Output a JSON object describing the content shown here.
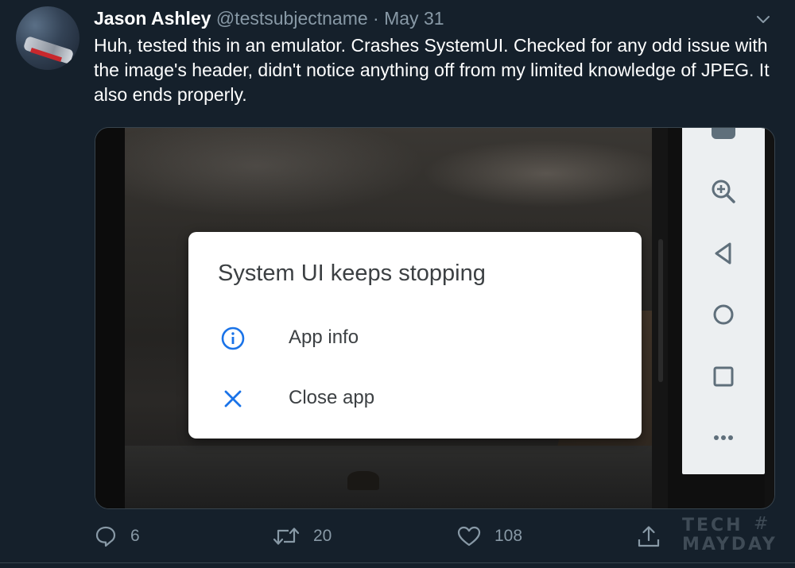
{
  "tweet": {
    "author": {
      "display_name": "Jason Ashley",
      "handle": "@testsubjectname",
      "separator": "·",
      "date": "May 31",
      "avatar_icon": "avatar-image"
    },
    "text": "Huh, tested this in an emulator. Crashes SystemUI. Checked for any odd issue with the image's header, didn't notice anything off from my limited knowledge of JPEG. It also ends properly.",
    "menu_icon": "chevron-down-icon"
  },
  "screenshot": {
    "dialog": {
      "title": "System UI keeps stopping",
      "options": [
        {
          "label": "App info",
          "icon": "info-icon"
        },
        {
          "label": "Close app",
          "icon": "close-icon"
        }
      ]
    },
    "emulator_toolbar": {
      "items": [
        "zoom-in-icon",
        "back-triangle-icon",
        "home-circle-icon",
        "overview-square-icon",
        "more-dots-icon"
      ]
    }
  },
  "actions": {
    "reply": {
      "icon": "reply-icon",
      "count": "6"
    },
    "retweet": {
      "icon": "retweet-icon",
      "count": "20"
    },
    "like": {
      "icon": "heart-icon",
      "count": "108"
    },
    "share": {
      "icon": "share-icon"
    }
  },
  "watermark": {
    "line1": "TECH",
    "hash": "#",
    "line2": "MAYDAY"
  },
  "colors": {
    "background": "#15202b",
    "secondary_text": "#8899a6",
    "border": "#38444d",
    "dialog_accent": "#1a73e8"
  }
}
